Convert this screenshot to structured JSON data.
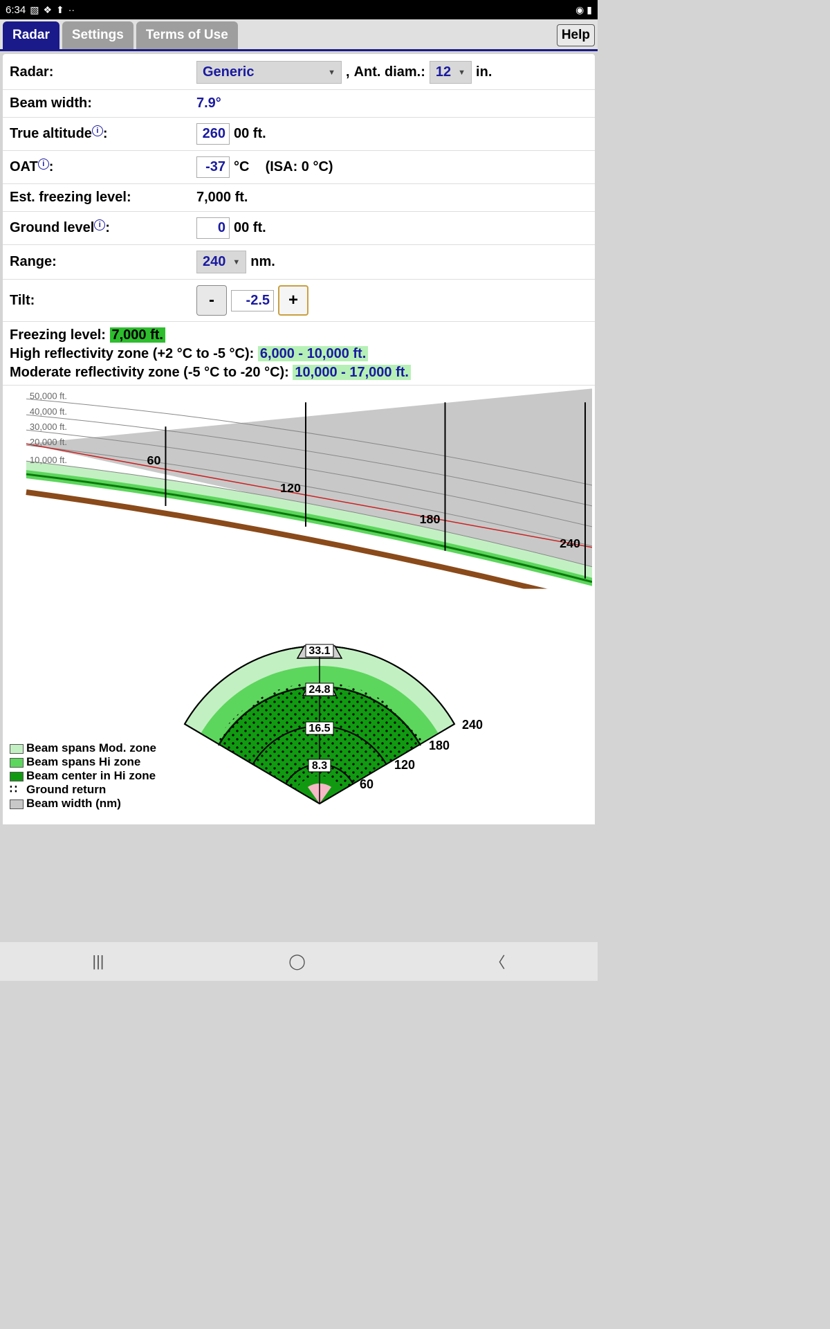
{
  "status": {
    "time": "6:34",
    "icons_left": [
      "image-icon",
      "dropbox-icon",
      "upload-icon",
      "more-icon"
    ],
    "icons_right": [
      "wifi-icon",
      "battery-icon"
    ]
  },
  "tabs": [
    {
      "label": "Radar",
      "active": true
    },
    {
      "label": "Settings",
      "active": false
    },
    {
      "label": "Terms of Use",
      "active": false
    }
  ],
  "help_label": "Help",
  "form": {
    "radar_label": "Radar:",
    "radar_value": "Generic",
    "comma": ", ",
    "ant_diam_label": "Ant. diam.:",
    "ant_diam_value": "12",
    "ant_diam_unit": "in.",
    "beam_width_label": "Beam width:",
    "beam_width_value": "7.9°",
    "true_alt_label": "True altitude",
    "true_alt_colon": ":",
    "true_alt_value": "260",
    "true_alt_suffix": "00 ft.",
    "oat_label": "OAT",
    "oat_colon": ":",
    "oat_value": "-37",
    "oat_unit": "°C",
    "oat_isa": "(ISA: 0 °C)",
    "est_freeze_label": "Est. freezing level:",
    "est_freeze_value": "7,000 ft.",
    "ground_label": "Ground level",
    "ground_colon": ":",
    "ground_value": "0",
    "ground_suffix": "00 ft.",
    "range_label": "Range:",
    "range_value": "240",
    "range_unit": "nm.",
    "tilt_label": "Tilt:",
    "tilt_minus": "-",
    "tilt_value": "-2.5",
    "tilt_plus": "+"
  },
  "info": {
    "freeze_label": "Freezing level: ",
    "freeze_value": "7,000 ft.",
    "hi_label": "High reflectivity zone (+2 °C to -5 °C): ",
    "hi_value": "6,000 - 10,000 ft.",
    "mod_label": "Moderate reflectivity zone (-5 °C to -20 °C): ",
    "mod_value": "10,000 - 17,000 ft."
  },
  "legend": {
    "mod": "Beam spans Mod. zone",
    "hi": "Beam spans Hi zone",
    "center": "Beam center in Hi zone",
    "ground": "Ground return",
    "width": "Beam width (nm)"
  },
  "chart_data": {
    "side_view": {
      "type": "profile",
      "altitude_ticks_ft": [
        10000,
        20000,
        30000,
        40000,
        50000
      ],
      "altitude_tick_labels": [
        "10,000 ft.",
        "20,000 ft.",
        "30,000 ft.",
        "40,000 ft.",
        "50,000 ft."
      ],
      "range_markers_nm": [
        60,
        120,
        180,
        240
      ],
      "aircraft_altitude_ft": 26000,
      "tilt_deg": -2.5,
      "beam_width_deg": 7.9,
      "freezing_level_ft": 7000,
      "hi_zone_ft": [
        6000,
        10000
      ],
      "mod_zone_ft": [
        10000,
        17000
      ]
    },
    "plan_view": {
      "type": "sector",
      "range_rings_nm": [
        60,
        120,
        180,
        240
      ],
      "beam_width_at_rings_nm": [
        8.3,
        16.5,
        24.8,
        33.1
      ],
      "sector_half_angle_deg": 60
    }
  }
}
